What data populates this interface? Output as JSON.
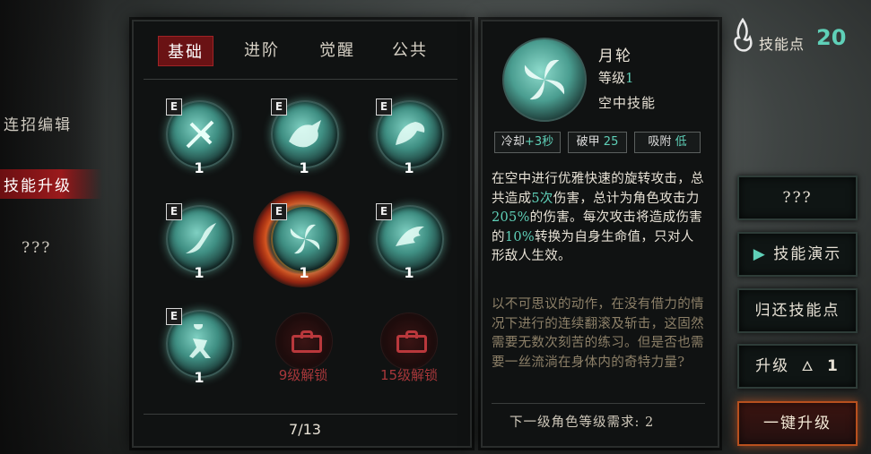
{
  "nav": {
    "items": [
      {
        "label": "连招编辑"
      },
      {
        "label": "技能升级"
      },
      {
        "label": "???"
      }
    ]
  },
  "tabs": [
    {
      "label": "基础"
    },
    {
      "label": "进阶"
    },
    {
      "label": "觉醒"
    },
    {
      "label": "公共"
    }
  ],
  "skills": [
    {
      "badge": "E",
      "level": "1",
      "icon": "sword-cross-icon"
    },
    {
      "badge": "E",
      "level": "1",
      "icon": "beast-icon"
    },
    {
      "badge": "E",
      "level": "1",
      "icon": "eagle-icon"
    },
    {
      "badge": "E",
      "level": "1",
      "icon": "slash-wave-icon"
    },
    {
      "badge": "E",
      "level": "1",
      "icon": "moon-wheel-icon"
    },
    {
      "badge": "E",
      "level": "1",
      "icon": "wing-blade-icon"
    },
    {
      "badge": "E",
      "level": "1",
      "icon": "fighter-icon"
    }
  ],
  "locked": [
    {
      "label": "9级解锁"
    },
    {
      "label": "15级解锁"
    }
  ],
  "pager": "7/13",
  "detail": {
    "name": "月轮",
    "level_label": "等级",
    "level_value": "1",
    "type": "空中技能",
    "chips": [
      {
        "label": "冷却",
        "value": "+3秒"
      },
      {
        "label": "破甲",
        "value": "25"
      },
      {
        "label": "吸附",
        "value": "低"
      }
    ],
    "desc": {
      "p1": "在空中进行优雅快速的旋转攻击，总共造成",
      "hits": "5次",
      "p2": "伤害，总计为角色攻击力",
      "pct1": "205%",
      "p3": "的伤害。每次攻击将造成伤害的",
      "pct2": "10%",
      "p4": "转换为自身生命值，只对人形敌人生效。"
    },
    "lore": "以不可思议的动作，在没有借力的情况下进行的连续翻滚及斩击，这固然需要无数次刻苦的练习。但是否也需要一丝流淌在身体内的奇特力量?",
    "next_req": "下一级角色等级需求: 2"
  },
  "skill_points": {
    "label": "技能点",
    "value": "20"
  },
  "buttons": {
    "b1": "???",
    "b2": "技能演示",
    "b3": "归还技能点",
    "b4_label": "升级",
    "b4_value": "1",
    "b5": "一键升级"
  },
  "colors": {
    "accent_green": "#5fd0b8",
    "active_red": "#6a1214",
    "primary_orange": "#b8501e"
  }
}
